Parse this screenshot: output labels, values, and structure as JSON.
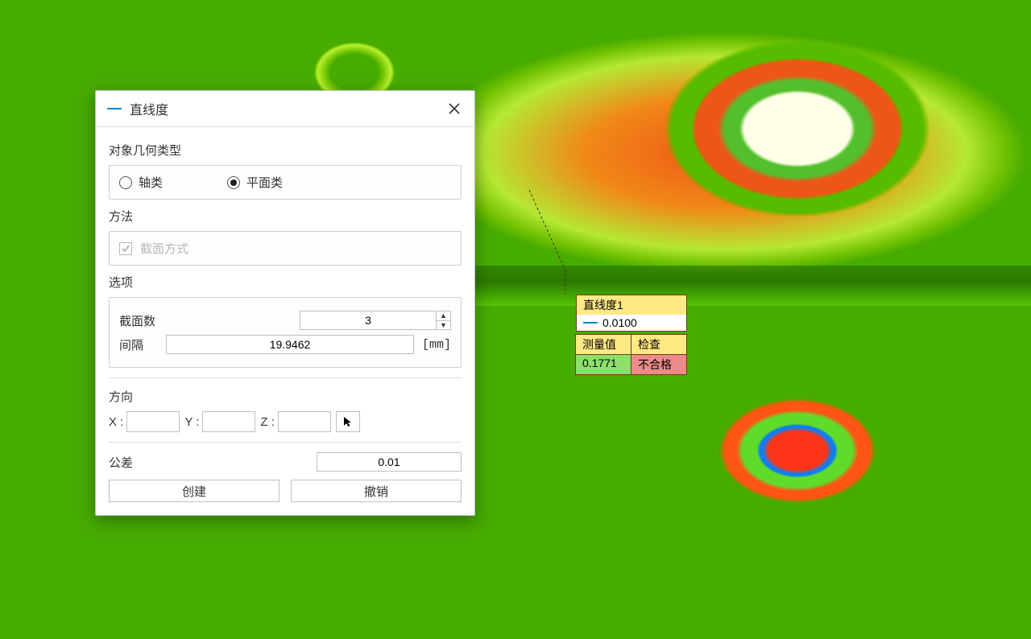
{
  "dialog": {
    "title": "直线度",
    "sections": {
      "geom_type_label": "对象几何类型",
      "radio_axis": "轴类",
      "radio_plane": "平面类",
      "method_label": "方法",
      "method_checkbox": "截面方式",
      "options_label": "选项",
      "section_count_label": "截面数",
      "section_count_value": "3",
      "interval_label": "间隔",
      "interval_value": "19.9462",
      "interval_unit": "[mm]",
      "direction_label": "方向",
      "x_label": "X :",
      "y_label": "Y :",
      "z_label": "Z :",
      "x_value": "",
      "y_value": "",
      "z_value": "",
      "tolerance_label": "公差",
      "tolerance_value": "0.01",
      "create_button": "创建",
      "undo_button": "撤销"
    }
  },
  "callout": {
    "title": "直线度1",
    "tolerance": "0.0100",
    "meas_header": "测量值",
    "check_header": "检查",
    "meas_value": "0.1771",
    "check_value": "不合格"
  }
}
